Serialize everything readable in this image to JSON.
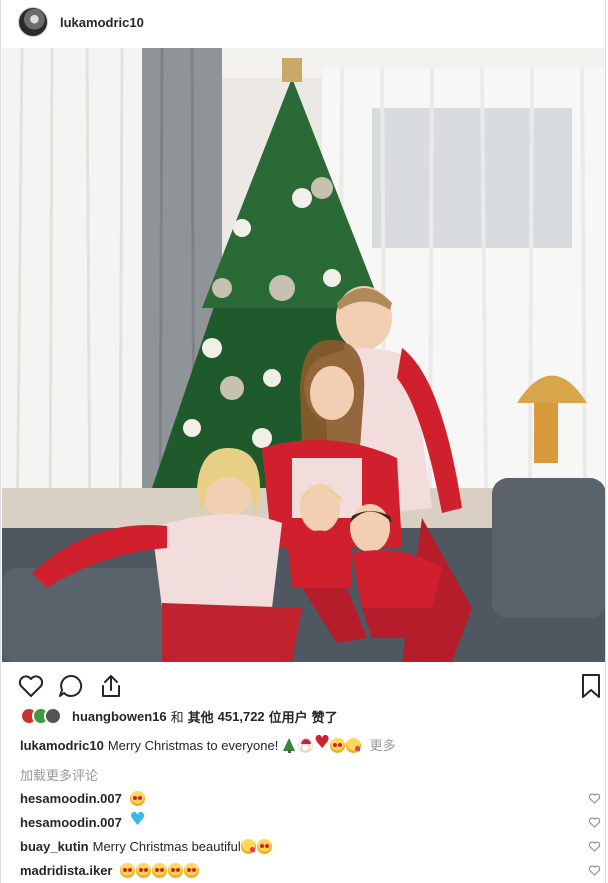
{
  "header": {
    "username": "lukamodric10"
  },
  "actions": {
    "like": "heart-icon",
    "comment": "comment-icon",
    "share": "share-icon",
    "save": "bookmark-icon"
  },
  "likes": {
    "first_user": "huangbowen16",
    "and_text": "和",
    "others_text": "其他",
    "count": "451,722",
    "users_text": "位用户",
    "liked_text": "赞了"
  },
  "caption": {
    "user": "lukamodric10",
    "text": "Merry Christmas to everyone!",
    "emojis": [
      "christmas-tree-emoji",
      "santa-emoji",
      "red-heart-emoji",
      "star-struck-emoji",
      "kiss-emoji"
    ],
    "more": "更多"
  },
  "load_more": "加载更多评论",
  "comments": [
    {
      "user": "hesamoodin.007",
      "text": "",
      "emojis": [
        "star-struck-emoji"
      ]
    },
    {
      "user": "hesamoodin.007",
      "text": "",
      "emojis": [
        "blue-heart-emoji"
      ]
    },
    {
      "user": "buay_kutin",
      "text": "Merry Christmas beautiful",
      "emojis": [
        "kiss-emoji",
        "star-struck-emoji"
      ]
    },
    {
      "user": "madridista.iker",
      "text": "",
      "emojis": [
        "star-struck-emoji",
        "star-struck-emoji",
        "star-struck-emoji",
        "star-struck-emoji",
        "star-struck-emoji"
      ]
    }
  ],
  "colors": {
    "text": "#262626",
    "muted": "#999999",
    "border": "#dbdbdb",
    "pajama_red": "#d0202e"
  }
}
